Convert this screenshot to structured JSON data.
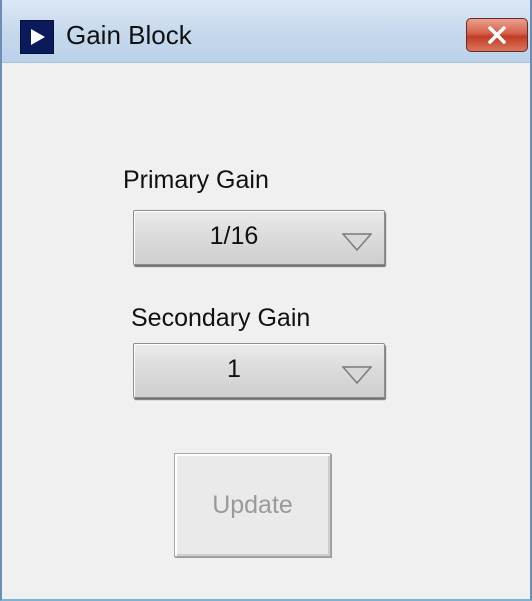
{
  "window": {
    "title": "Gain Block",
    "app_icon": "labview-run-arrow-icon",
    "close_icon": "close-icon"
  },
  "primary_gain": {
    "label": "Primary Gain",
    "value": "1/16",
    "arrow_icon": "chevron-down-icon"
  },
  "secondary_gain": {
    "label": "Secondary Gain",
    "value": "1",
    "arrow_icon": "chevron-down-icon"
  },
  "update_button": {
    "label": "Update",
    "state": "disabled"
  },
  "colors": {
    "titlebar": "#c5d8ec",
    "close_button": "#c23b23",
    "panel_background": "#f0f0f0",
    "disabled_text": "#9a9a9a"
  }
}
